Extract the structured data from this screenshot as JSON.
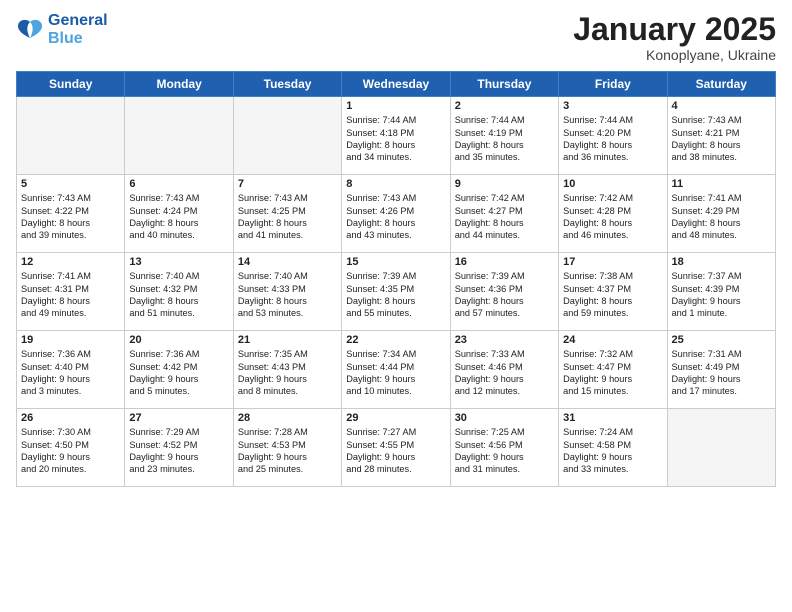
{
  "logo": {
    "line1": "General",
    "line2": "Blue"
  },
  "title": "January 2025",
  "subtitle": "Konoplyane, Ukraine",
  "weekdays": [
    "Sunday",
    "Monday",
    "Tuesday",
    "Wednesday",
    "Thursday",
    "Friday",
    "Saturday"
  ],
  "weeks": [
    [
      {
        "day": "",
        "info": ""
      },
      {
        "day": "",
        "info": ""
      },
      {
        "day": "",
        "info": ""
      },
      {
        "day": "1",
        "info": "Sunrise: 7:44 AM\nSunset: 4:18 PM\nDaylight: 8 hours\nand 34 minutes."
      },
      {
        "day": "2",
        "info": "Sunrise: 7:44 AM\nSunset: 4:19 PM\nDaylight: 8 hours\nand 35 minutes."
      },
      {
        "day": "3",
        "info": "Sunrise: 7:44 AM\nSunset: 4:20 PM\nDaylight: 8 hours\nand 36 minutes."
      },
      {
        "day": "4",
        "info": "Sunrise: 7:43 AM\nSunset: 4:21 PM\nDaylight: 8 hours\nand 38 minutes."
      }
    ],
    [
      {
        "day": "5",
        "info": "Sunrise: 7:43 AM\nSunset: 4:22 PM\nDaylight: 8 hours\nand 39 minutes."
      },
      {
        "day": "6",
        "info": "Sunrise: 7:43 AM\nSunset: 4:24 PM\nDaylight: 8 hours\nand 40 minutes."
      },
      {
        "day": "7",
        "info": "Sunrise: 7:43 AM\nSunset: 4:25 PM\nDaylight: 8 hours\nand 41 minutes."
      },
      {
        "day": "8",
        "info": "Sunrise: 7:43 AM\nSunset: 4:26 PM\nDaylight: 8 hours\nand 43 minutes."
      },
      {
        "day": "9",
        "info": "Sunrise: 7:42 AM\nSunset: 4:27 PM\nDaylight: 8 hours\nand 44 minutes."
      },
      {
        "day": "10",
        "info": "Sunrise: 7:42 AM\nSunset: 4:28 PM\nDaylight: 8 hours\nand 46 minutes."
      },
      {
        "day": "11",
        "info": "Sunrise: 7:41 AM\nSunset: 4:29 PM\nDaylight: 8 hours\nand 48 minutes."
      }
    ],
    [
      {
        "day": "12",
        "info": "Sunrise: 7:41 AM\nSunset: 4:31 PM\nDaylight: 8 hours\nand 49 minutes."
      },
      {
        "day": "13",
        "info": "Sunrise: 7:40 AM\nSunset: 4:32 PM\nDaylight: 8 hours\nand 51 minutes."
      },
      {
        "day": "14",
        "info": "Sunrise: 7:40 AM\nSunset: 4:33 PM\nDaylight: 8 hours\nand 53 minutes."
      },
      {
        "day": "15",
        "info": "Sunrise: 7:39 AM\nSunset: 4:35 PM\nDaylight: 8 hours\nand 55 minutes."
      },
      {
        "day": "16",
        "info": "Sunrise: 7:39 AM\nSunset: 4:36 PM\nDaylight: 8 hours\nand 57 minutes."
      },
      {
        "day": "17",
        "info": "Sunrise: 7:38 AM\nSunset: 4:37 PM\nDaylight: 8 hours\nand 59 minutes."
      },
      {
        "day": "18",
        "info": "Sunrise: 7:37 AM\nSunset: 4:39 PM\nDaylight: 9 hours\nand 1 minute."
      }
    ],
    [
      {
        "day": "19",
        "info": "Sunrise: 7:36 AM\nSunset: 4:40 PM\nDaylight: 9 hours\nand 3 minutes."
      },
      {
        "day": "20",
        "info": "Sunrise: 7:36 AM\nSunset: 4:42 PM\nDaylight: 9 hours\nand 5 minutes."
      },
      {
        "day": "21",
        "info": "Sunrise: 7:35 AM\nSunset: 4:43 PM\nDaylight: 9 hours\nand 8 minutes."
      },
      {
        "day": "22",
        "info": "Sunrise: 7:34 AM\nSunset: 4:44 PM\nDaylight: 9 hours\nand 10 minutes."
      },
      {
        "day": "23",
        "info": "Sunrise: 7:33 AM\nSunset: 4:46 PM\nDaylight: 9 hours\nand 12 minutes."
      },
      {
        "day": "24",
        "info": "Sunrise: 7:32 AM\nSunset: 4:47 PM\nDaylight: 9 hours\nand 15 minutes."
      },
      {
        "day": "25",
        "info": "Sunrise: 7:31 AM\nSunset: 4:49 PM\nDaylight: 9 hours\nand 17 minutes."
      }
    ],
    [
      {
        "day": "26",
        "info": "Sunrise: 7:30 AM\nSunset: 4:50 PM\nDaylight: 9 hours\nand 20 minutes."
      },
      {
        "day": "27",
        "info": "Sunrise: 7:29 AM\nSunset: 4:52 PM\nDaylight: 9 hours\nand 23 minutes."
      },
      {
        "day": "28",
        "info": "Sunrise: 7:28 AM\nSunset: 4:53 PM\nDaylight: 9 hours\nand 25 minutes."
      },
      {
        "day": "29",
        "info": "Sunrise: 7:27 AM\nSunset: 4:55 PM\nDaylight: 9 hours\nand 28 minutes."
      },
      {
        "day": "30",
        "info": "Sunrise: 7:25 AM\nSunset: 4:56 PM\nDaylight: 9 hours\nand 31 minutes."
      },
      {
        "day": "31",
        "info": "Sunrise: 7:24 AM\nSunset: 4:58 PM\nDaylight: 9 hours\nand 33 minutes."
      },
      {
        "day": "",
        "info": ""
      }
    ]
  ]
}
